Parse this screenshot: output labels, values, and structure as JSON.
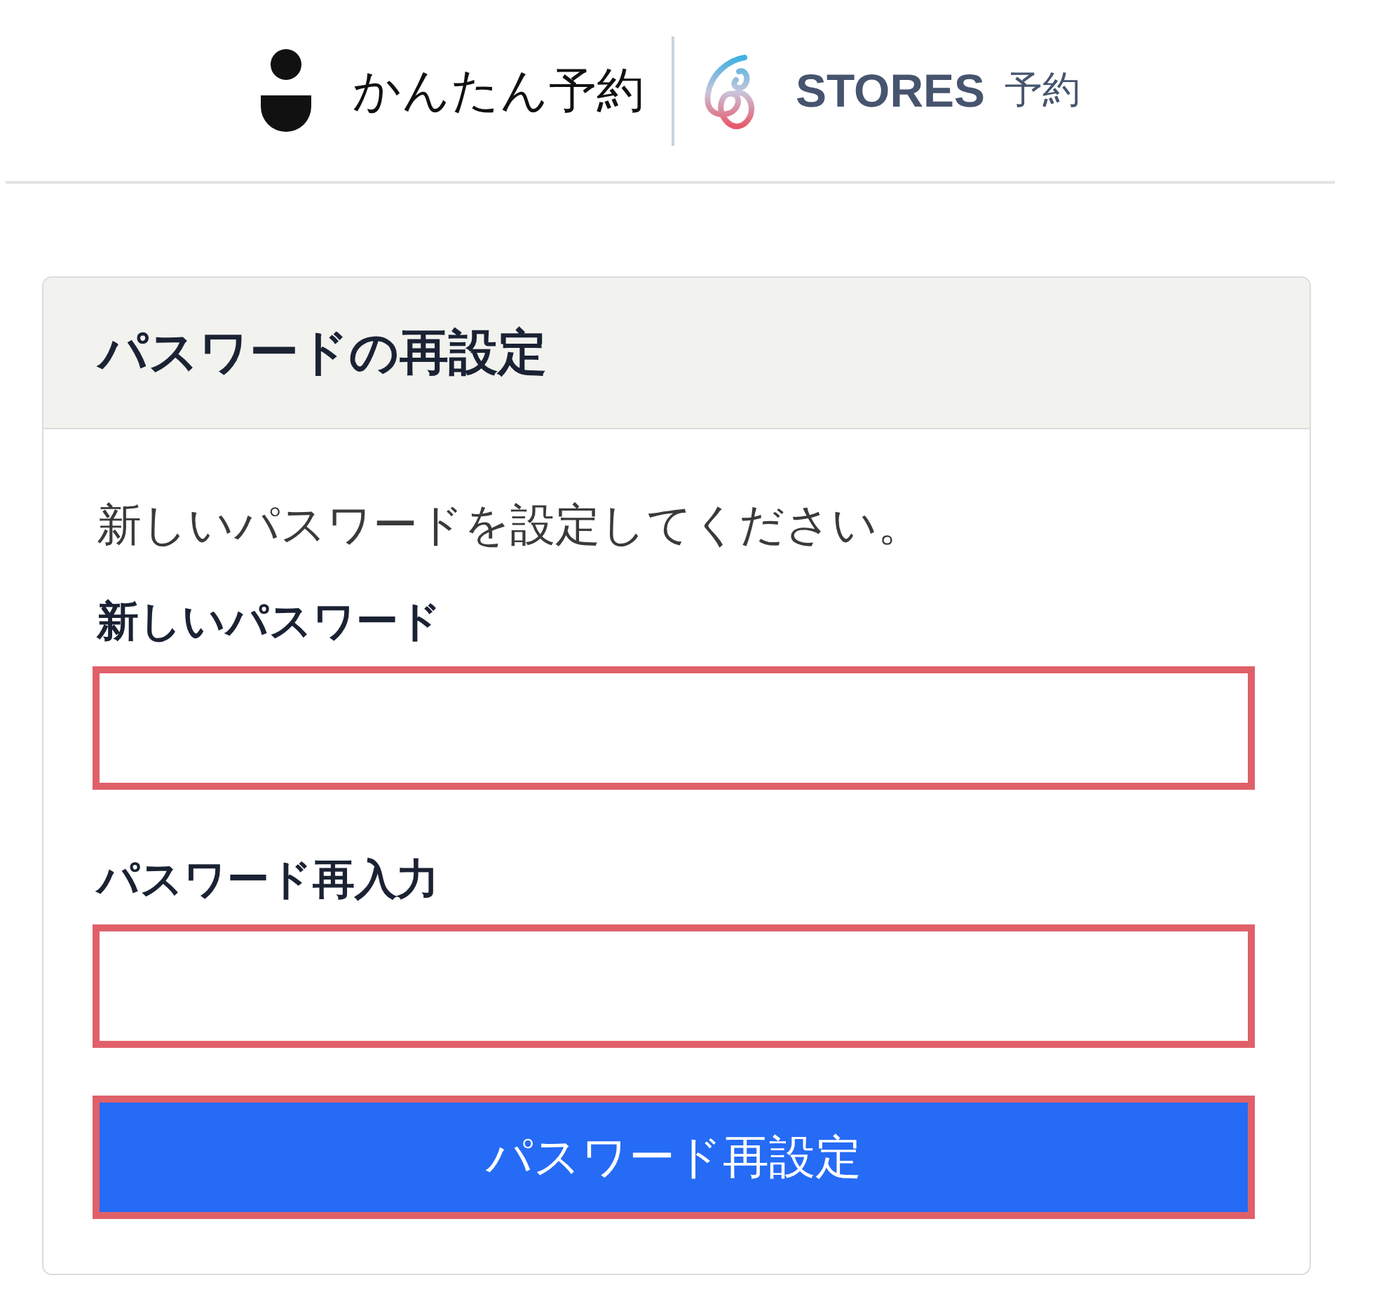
{
  "header": {
    "logo_text": "かんたん予約",
    "partner_logo_text": "STORES",
    "partner_logo_suffix": "予約"
  },
  "card": {
    "title": "パスワードの再設定",
    "description": "新しいパスワードを設定してください。",
    "fields": [
      {
        "label": "新しいパスワード",
        "highlighted": true
      },
      {
        "label": "パスワード再入力",
        "highlighted": true
      }
    ],
    "submit_button": {
      "label": "パスワード再設定",
      "highlighted": true
    }
  }
}
